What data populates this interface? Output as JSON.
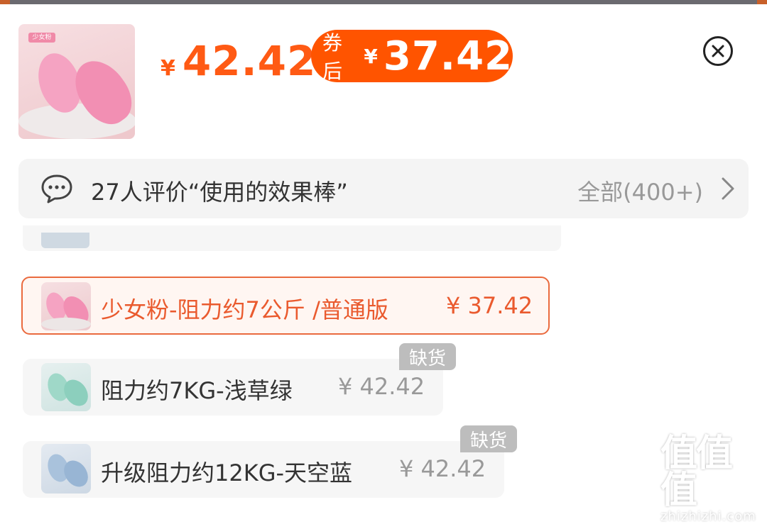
{
  "product": {
    "price_currency": "¥",
    "price": "42.42",
    "coupon_label": "券后",
    "coupon_currency": "¥",
    "coupon_price": "37.42",
    "thumb_tag": "少女粉"
  },
  "review": {
    "summary": "27人评价“使用的效果棒”",
    "all_label": "全部(400+)"
  },
  "options": [
    {
      "label": "少女粉-阻力约7公斤 /普通版",
      "price": "¥ 37.42",
      "selected": true,
      "out_of_stock": false
    },
    {
      "label": "阻力约7KG-浅草绿",
      "price": "¥ 42.42",
      "selected": false,
      "out_of_stock": true,
      "badge": "缺货"
    },
    {
      "label": "升级阻力约12KG-天空蓝",
      "price": "¥ 42.42",
      "selected": false,
      "out_of_stock": true,
      "badge": "缺货"
    }
  ],
  "watermark": {
    "logo": "值值值",
    "site": "zhizhizhi.com"
  },
  "colors": {
    "accent": "#ff5400",
    "selected_border": "#ea6a3e",
    "muted": "#999999"
  },
  "icons": [
    "close-icon",
    "chat-bubble-icon",
    "chevron-right-icon"
  ]
}
